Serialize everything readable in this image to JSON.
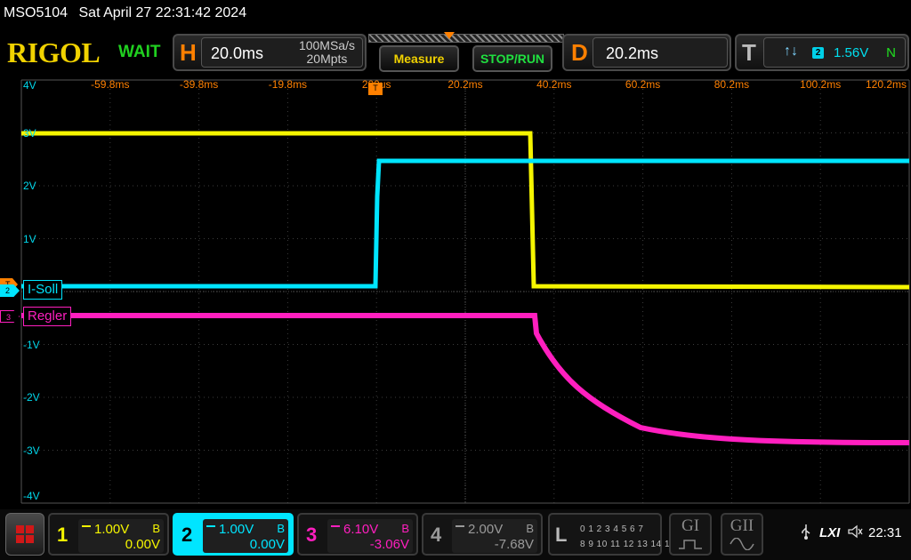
{
  "titlebar": {
    "model": "MSO5104",
    "datetime": "Sat April 27 22:31:42 2024"
  },
  "toolbar": {
    "brand": "RIGOL",
    "status": "WAIT",
    "horizontal": {
      "letter": "H",
      "timebase": "20.0ms",
      "sample_rate": "100MSa/s",
      "memory_depth": "20Mpts"
    },
    "measure_label": "Measure",
    "stop_run_label": "STOP/RUN",
    "delay": {
      "letter": "D",
      "value": "20.2ms"
    },
    "trigger": {
      "letter": "T",
      "edge_icon": "rise-fall-edge-icon",
      "source": "2",
      "level": "1.56V",
      "mode": "N"
    }
  },
  "graticule": {
    "time_labels": [
      "-59.8ms",
      "-39.8ms",
      "-19.8ms",
      "200us",
      "20.2ms",
      "40.2ms",
      "60.2ms",
      "80.2ms",
      "100.2ms",
      "120.2ms"
    ],
    "volt_labels": [
      "4V",
      "3V",
      "2V",
      "1V",
      "0V",
      "-1V",
      "-2V",
      "-3V",
      "-4V"
    ],
    "trigger_marker": "T",
    "trigger_position_marker": "T"
  },
  "channel_labels": {
    "ch2": {
      "marker": "2",
      "name": "I-Soll",
      "color": "#00e5ff"
    },
    "ch3": {
      "marker": "3",
      "name": "Regler",
      "color": "#ff1fbf"
    }
  },
  "waveforms": {
    "ch1_color": "#f5f500",
    "ch2_color": "#00e5ff",
    "ch3_color": "#ff1fbf"
  },
  "channels": [
    {
      "num": "1",
      "vdiv": "1.00V",
      "coupling": "B",
      "offset": "0.00V",
      "color": "#f5f500"
    },
    {
      "num": "2",
      "vdiv": "1.00V",
      "coupling": "B",
      "offset": "0.00V",
      "color": "#00e5ff"
    },
    {
      "num": "3",
      "vdiv": "6.10V",
      "coupling": "B",
      "offset": "-3.06V",
      "color": "#ff1fbf"
    },
    {
      "num": "4",
      "vdiv": "2.00V",
      "coupling": "B",
      "offset": "-7.68V",
      "color": "#9a9a9a"
    }
  ],
  "logic": {
    "letter": "L",
    "row1": "0 1 2 3  4 5 6 7",
    "row2": "8 9 10 11 12 13 14 15"
  },
  "generators": {
    "g1": "GI",
    "g2": "GII"
  },
  "system": {
    "usb_icon": "usb-icon",
    "lxi": "LXI",
    "sound_icon": "speaker-mute-icon",
    "clock": "22:31"
  }
}
